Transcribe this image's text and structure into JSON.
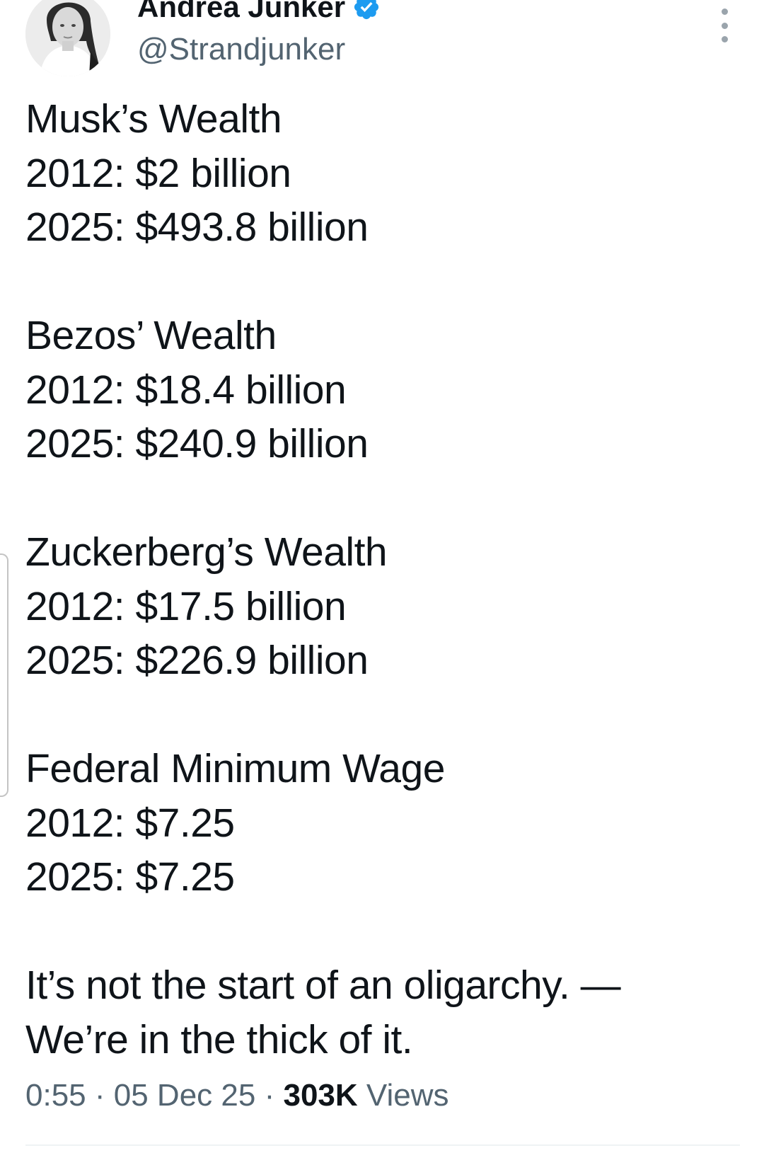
{
  "author": {
    "display_name": "Andrea Junker",
    "handle": "@Strandjunker",
    "verified_icon": "verified-badge-icon",
    "accent_color": "#1d9bf0"
  },
  "tweet": {
    "sections": [
      {
        "heading": "Musk’s Wealth",
        "lines": [
          "2012: $2 billion",
          "2025: $493.8 billion"
        ]
      },
      {
        "heading": "Bezos’ Wealth",
        "lines": [
          "2012: $18.4 billion",
          "2025: $240.9 billion"
        ]
      },
      {
        "heading": "Zuckerberg’s Wealth",
        "lines": [
          "2012: $17.5 billion",
          "2025: $226.9 billion"
        ]
      },
      {
        "heading": "Federal Minimum Wage",
        "lines": [
          "2012: $7.25",
          "2025: $7.25"
        ]
      }
    ],
    "closing": [
      "It’s not the start of an oligarchy. —",
      "We’re in the thick of it."
    ]
  },
  "meta": {
    "time": "0:55",
    "date": "05 Dec 25",
    "views_count": "303K",
    "views_label": "Views",
    "separator": "·"
  }
}
